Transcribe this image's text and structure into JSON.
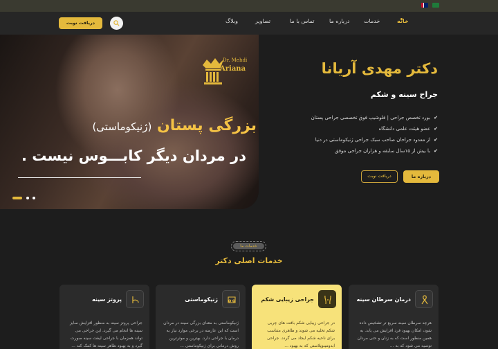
{
  "topbar": {
    "languages": [
      "en",
      "ar"
    ]
  },
  "nav": {
    "items": [
      {
        "label": "خانه",
        "active": true
      },
      {
        "label": "خدمات"
      },
      {
        "label": "درباره ما"
      },
      {
        "label": "تماس با ما"
      },
      {
        "label": "تصاویر"
      },
      {
        "label": "وبلاگ"
      }
    ],
    "cta_label": "دریافت نوبت",
    "search_icon": "search-icon"
  },
  "hero": {
    "logo_line1": "Dr. Mehdi",
    "logo_line2": "Ariana",
    "headline_main": "بزرگی پستان",
    "headline_paren": "(ژنیکوماستی)",
    "headline_line2": "در مردان دیگر کابـــوس نیست ."
  },
  "doctor": {
    "name": "دکتر مهدی آریانا",
    "title": "جراح سینه و شکم",
    "credentials": [
      "بورد تخصص جراحی | فلوشیپ فوق تخصصی جراحی پستان",
      "عضو هیئت علمی دانشگاه",
      "از معدود جراحان صاحب سبک جراحی ژنیکوماستی در دنیا",
      "با بیش از ۱۵سال سابقه و هزاران جراحی موفق"
    ],
    "about_button": "درباره ما",
    "appointment_button": "دریافت نوبت"
  },
  "services": {
    "badge": "خدمات ما",
    "title": "خدمات اصلی دکتر",
    "cards": [
      {
        "title": "درمان سرطان سینه",
        "icon": "ribbon-icon",
        "text": "هرچه سرطان سینه سریع تر تشخیص داده شود، امکان بهبود فرد افزایش می یابد. به همین منظور است که به زنان و حتی مردان توصیه می شود که به ...",
        "highlight": false
      },
      {
        "title": "جراحی زیبایی شکم",
        "icon": "abdomen-icon",
        "text": "در جراحی زیبایی شکم بافت های چربی شکم تخلیه می شوند و ظاهری متناسب برای ناحیه شکم ایجاد می گردد. جراحی ابدومینوپلاستی که به بهبود ...",
        "highlight": true
      },
      {
        "title": "ژنیکوماستی",
        "icon": "chest-icon",
        "text": "ژنیکوماستی به معنای بزرگی سینه در مردان است که این عارضه در برخی موارد نیاز به درمان با جراحی دارد. بهترین و موثرترین روش درمانی برای ژنیکوماستی ...",
        "highlight": false
      },
      {
        "title": "پروتز سینه",
        "icon": "implant-icon",
        "text": "جراحی پروتز سینه به منظور افزایش سایز سینه ها انجام می گیرد. این جراحی می تواند همزمان با جراحی لیفت سینه صورت گیرد و به بهبود ظاهر سینه ها کمک کند ...",
        "highlight": false
      }
    ]
  },
  "colors": {
    "accent": "#e4b93c",
    "background": "#1d1d1d"
  }
}
